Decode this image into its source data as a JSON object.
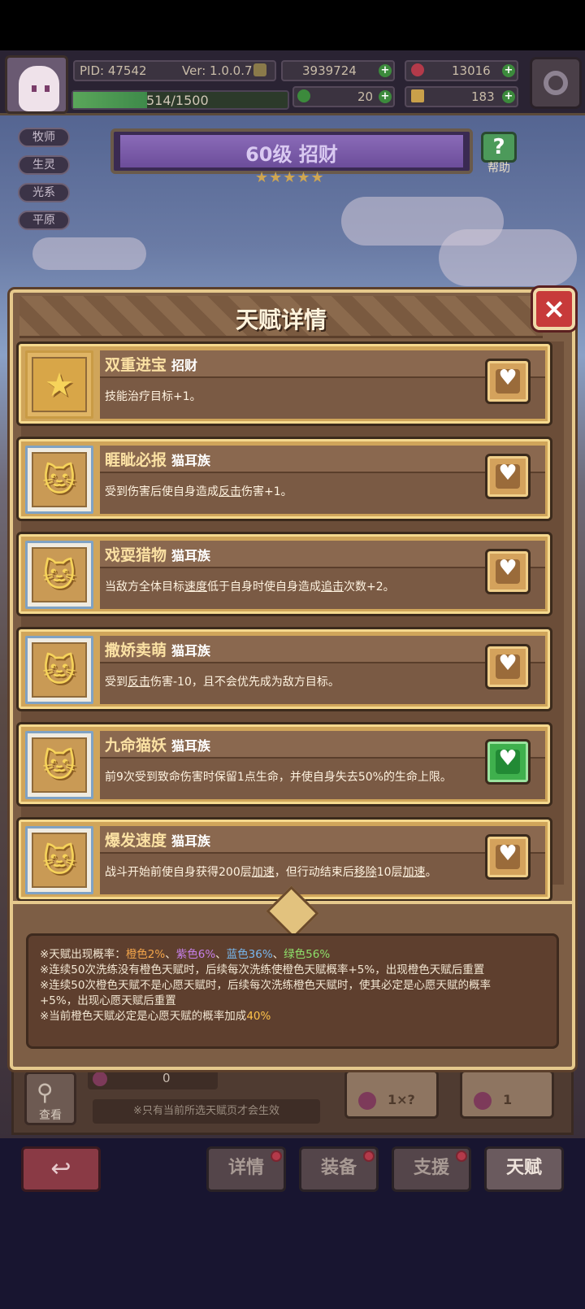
{
  "header": {
    "pid": "PID: 47542",
    "version": "Ver: 1.0.0.7",
    "gold": "3939724",
    "gems": "13016",
    "xp": "514/1500",
    "xp_fraction": 0.343,
    "clover": "20",
    "boots": "183"
  },
  "tags": [
    "牧师",
    "生灵",
    "光系",
    "平原"
  ],
  "banner": {
    "level_text": "60级 招财",
    "stars": "★★★★★",
    "help": "帮助",
    "help_icon": "?"
  },
  "modal": {
    "title": "天赋详情",
    "close": "×",
    "talents": [
      {
        "name": "双重进宝",
        "race": "招财",
        "desc": [
          "技能治疗目标+1。"
        ],
        "icon": "star-icon",
        "fav": false
      },
      {
        "name": "睚眦必报",
        "race": "猫耳族",
        "desc": [
          "受到伤害后使自身造成",
          "反击",
          "伤害+1。"
        ],
        "icon": "cat-icon",
        "fav": false
      },
      {
        "name": "戏耍猎物",
        "race": "猫耳族",
        "desc": [
          "当敌方全体目标",
          "速度",
          "低于自身时使自身造成",
          "追击",
          "次数+2。"
        ],
        "icon": "cat-icon",
        "fav": false
      },
      {
        "name": "撒娇卖萌",
        "race": "猫耳族",
        "desc": [
          "受到",
          "反击",
          "伤害-10，且不会优先成为敌方目标。"
        ],
        "icon": "cat-icon",
        "fav": false
      },
      {
        "name": "九命猫妖",
        "race": "猫耳族",
        "desc": [
          "前9次受到致命伤害时保留1点生命，并使自身失去50%的生命上限。"
        ],
        "icon": "cat-icon",
        "fav": true
      },
      {
        "name": "爆发速度",
        "race": "猫耳族",
        "desc": [
          "战斗开始前使自身获得200层",
          "加速",
          "，但行动结束后",
          "移除",
          "10层",
          "加速",
          "。"
        ],
        "icon": "cat-icon",
        "fav": false
      }
    ],
    "info": {
      "line1_prefix": "※天赋出现概率：",
      "orange": "橙色2%",
      "sep1": "、",
      "purple": "紫色6%",
      "sep2": "、",
      "blue": "蓝色36%",
      "sep3": "、",
      "green": "绿色56%",
      "line2": "※连续50次洗练没有橙色天赋时，后续每次洗练使橙色天赋概率+5%，出现橙色天赋后重置",
      "line3a": "※连续50次橙色天赋不是心愿天赋时，后续每次洗练橙色天赋时，使其必定是心愿天赋的概率",
      "line3b": "+5%，出现心愿天赋后重置",
      "line4_prefix": "※当前橙色天赋必定是心愿天赋的概率加成",
      "line4_value": "40%"
    }
  },
  "lower": {
    "search_label": "查看",
    "count": "0",
    "note": "※只有当前所选天赋页才会生效",
    "wash1_value": "1×?",
    "wash2_value": "1"
  },
  "nav": {
    "back": "↩",
    "detail": "详情",
    "equip": "装备",
    "support": "支援",
    "talent": "天赋"
  },
  "colors": {
    "orange": "#f3a54a",
    "purple": "#c67fe7",
    "blue": "#78b7ee",
    "green": "#8ee06a",
    "highlight": "#ffc34a"
  }
}
